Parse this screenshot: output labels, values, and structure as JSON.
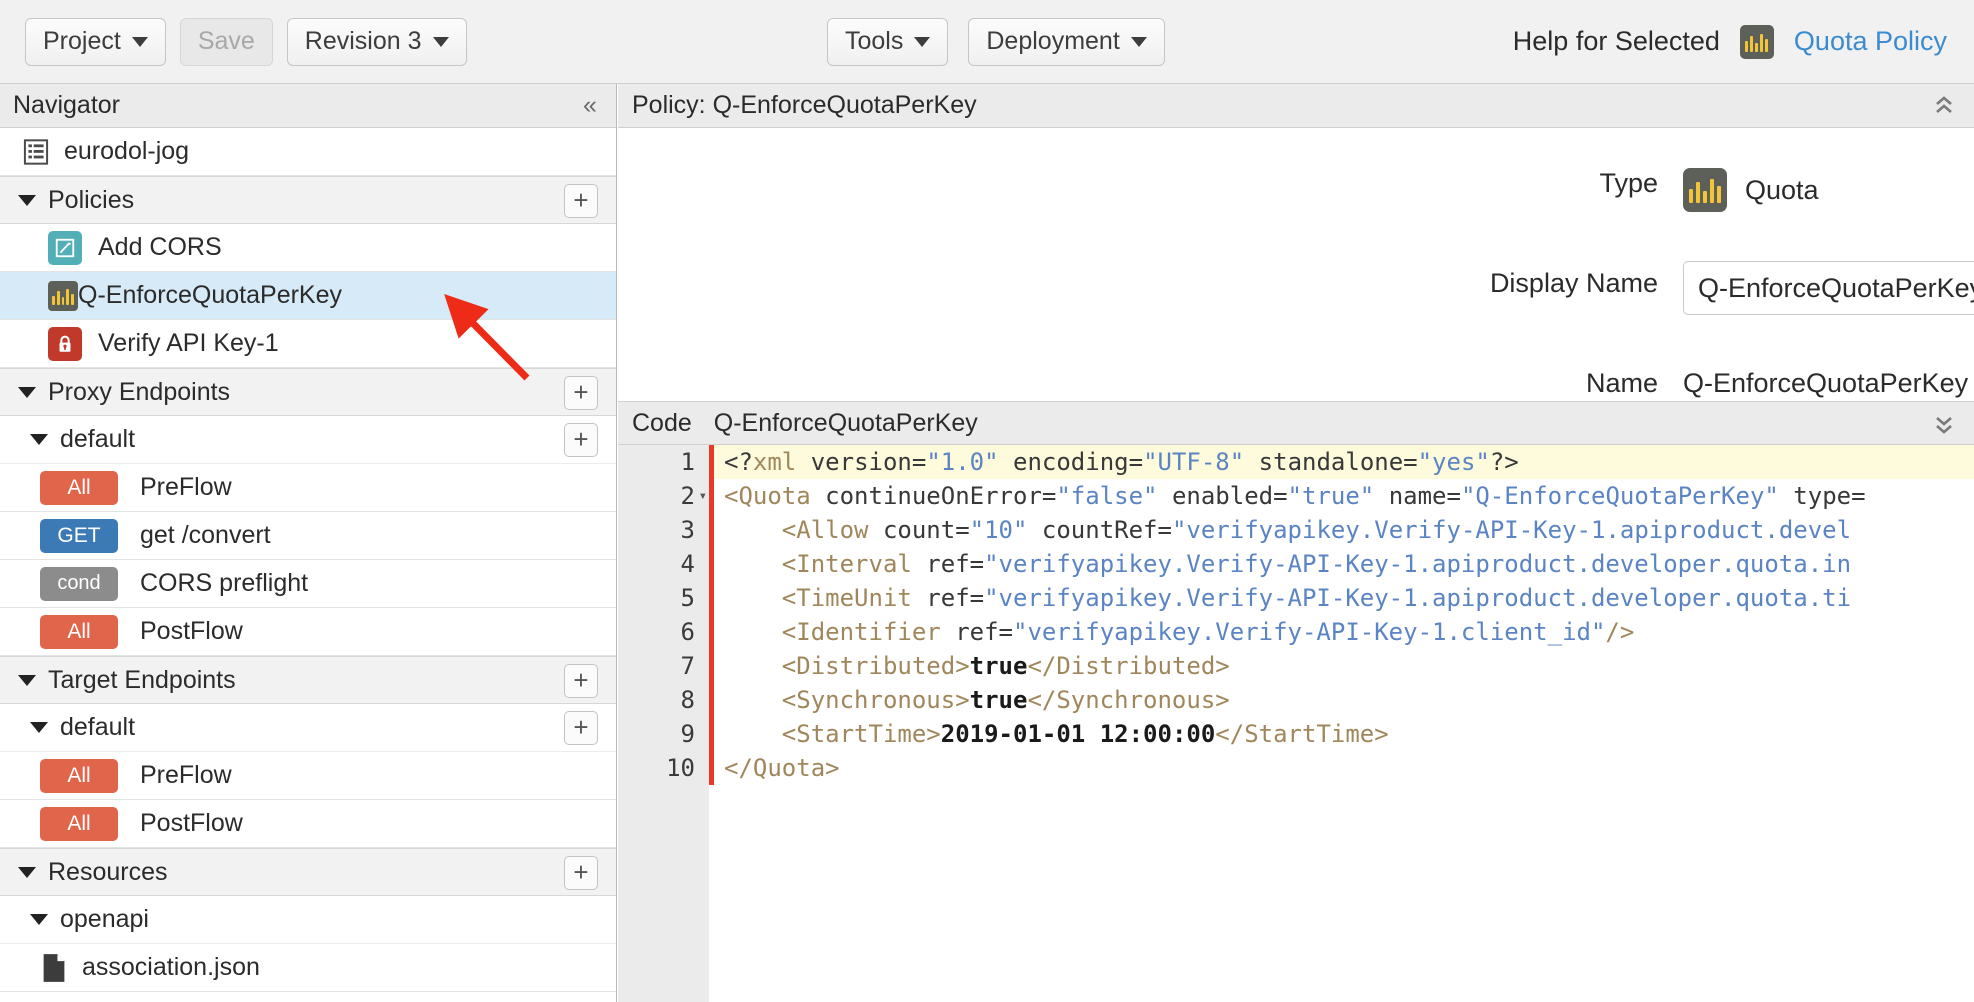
{
  "toolbar": {
    "project_label": "Project",
    "save_label": "Save",
    "revision_label": "Revision 3",
    "tools_label": "Tools",
    "deployment_label": "Deployment",
    "help_label": "Help for Selected",
    "quota_policy_link": "Quota Policy",
    "quota_icon": "quota-policy-icon",
    "accent_link_color": "#3b8bd0"
  },
  "sidebar": {
    "header": "Navigator",
    "collapse_icon": "«",
    "proxy_name": "eurodol-jog",
    "groups": [
      {
        "label": "Policies",
        "add_label": "+",
        "items": [
          {
            "label": "Add CORS",
            "icon": "edit-pencil-icon",
            "icon_color": "#52afb8",
            "selected": false
          },
          {
            "label": "Q-EnforceQuotaPerKey",
            "icon": "quota-policy-icon",
            "icon_color": "#5c6059",
            "selected": true
          },
          {
            "label": "Verify API Key-1",
            "icon": "padlock-icon",
            "icon_color": "#c0392b",
            "selected": false
          }
        ]
      },
      {
        "label": "Proxy Endpoints",
        "add_label": "+",
        "endpoint": "default",
        "endpoint_add_label": "+",
        "flows": [
          {
            "badge": "All",
            "badge_type": "all",
            "label": "PreFlow"
          },
          {
            "badge": "GET",
            "badge_type": "get",
            "label": "get /convert"
          },
          {
            "badge": "cond",
            "badge_type": "cond",
            "label": "CORS preflight"
          },
          {
            "badge": "All",
            "badge_type": "all",
            "label": "PostFlow"
          }
        ]
      },
      {
        "label": "Target Endpoints",
        "add_label": "+",
        "endpoint": "default",
        "endpoint_add_label": "+",
        "flows": [
          {
            "badge": "All",
            "badge_type": "all",
            "label": "PreFlow"
          },
          {
            "badge": "All",
            "badge_type": "all",
            "label": "PostFlow"
          }
        ]
      },
      {
        "label": "Resources",
        "add_label": "+",
        "folder": "openapi",
        "files": [
          {
            "label": "association.json",
            "icon": "file-icon"
          }
        ]
      }
    ],
    "badge_colors": {
      "all": "#e0654a",
      "get": "#3c7ab5",
      "cond": "#8c8c8c"
    }
  },
  "policy_panel": {
    "header": "Policy: Q-EnforceQuotaPerKey",
    "collapse_icon": "chevron-double-up-icon",
    "type_label": "Type",
    "type_value": "Quota",
    "type_icon": "quota-policy-icon",
    "display_name_label": "Display Name",
    "display_name_value": "Q-EnforceQuotaPerKey",
    "display_name_placeholder": "Display Name",
    "name_label": "Name",
    "name_value": "Q-EnforceQuotaPerKey"
  },
  "code_panel": {
    "code_label": "Code",
    "file_name": "Q-EnforceQuotaPerKey",
    "expand_icon": "chevron-double-down-icon",
    "line_numbers": [
      "1",
      "2",
      "3",
      "4",
      "5",
      "6",
      "7",
      "8",
      "9",
      "10"
    ],
    "lines": [
      {
        "n": "1",
        "highlighted": true,
        "foldable": false,
        "tokens": [
          {
            "t": "<?",
            "c": "punct"
          },
          {
            "t": "xml",
            "c": "proc"
          },
          {
            "t": " version=",
            "c": "attr"
          },
          {
            "t": "\"1.0\"",
            "c": "str"
          },
          {
            "t": " encoding=",
            "c": "attr"
          },
          {
            "t": "\"UTF-8\"",
            "c": "str"
          },
          {
            "t": " standalone=",
            "c": "attr"
          },
          {
            "t": "\"yes\"",
            "c": "str"
          },
          {
            "t": "?>",
            "c": "punct"
          }
        ]
      },
      {
        "n": "2",
        "highlighted": false,
        "foldable": true,
        "tokens": [
          {
            "t": "<Quota",
            "c": "tag"
          },
          {
            "t": " continueOnError=",
            "c": "attr"
          },
          {
            "t": "\"false\"",
            "c": "str"
          },
          {
            "t": " enabled=",
            "c": "attr"
          },
          {
            "t": "\"true\"",
            "c": "str"
          },
          {
            "t": " name=",
            "c": "attr"
          },
          {
            "t": "\"Q-EnforceQuotaPerKey\"",
            "c": "str"
          },
          {
            "t": " type=",
            "c": "attr"
          }
        ]
      },
      {
        "n": "3",
        "highlighted": false,
        "foldable": false,
        "tokens": [
          {
            "t": "    <Allow",
            "c": "tag"
          },
          {
            "t": " count=",
            "c": "attr"
          },
          {
            "t": "\"10\"",
            "c": "str"
          },
          {
            "t": " countRef=",
            "c": "attr"
          },
          {
            "t": "\"verifyapikey.Verify-API-Key-1.apiproduct.devel",
            "c": "str"
          }
        ]
      },
      {
        "n": "4",
        "highlighted": false,
        "foldable": false,
        "tokens": [
          {
            "t": "    <Interval",
            "c": "tag"
          },
          {
            "t": " ref=",
            "c": "attr"
          },
          {
            "t": "\"verifyapikey.Verify-API-Key-1.apiproduct.developer.quota.in",
            "c": "str"
          }
        ]
      },
      {
        "n": "5",
        "highlighted": false,
        "foldable": false,
        "tokens": [
          {
            "t": "    <TimeUnit",
            "c": "tag"
          },
          {
            "t": " ref=",
            "c": "attr"
          },
          {
            "t": "\"verifyapikey.Verify-API-Key-1.apiproduct.developer.quota.ti",
            "c": "str"
          }
        ]
      },
      {
        "n": "6",
        "highlighted": false,
        "foldable": false,
        "tokens": [
          {
            "t": "    <Identifier",
            "c": "tag"
          },
          {
            "t": " ref=",
            "c": "attr"
          },
          {
            "t": "\"verifyapikey.Verify-API-Key-1.client_id\"",
            "c": "str"
          },
          {
            "t": "/>",
            "c": "tag"
          }
        ]
      },
      {
        "n": "7",
        "highlighted": false,
        "foldable": false,
        "tokens": [
          {
            "t": "    <Distributed>",
            "c": "tag"
          },
          {
            "t": "true",
            "c": "text"
          },
          {
            "t": "</Distributed>",
            "c": "tag"
          }
        ]
      },
      {
        "n": "8",
        "highlighted": false,
        "foldable": false,
        "tokens": [
          {
            "t": "    <Synchronous>",
            "c": "tag"
          },
          {
            "t": "true",
            "c": "text"
          },
          {
            "t": "</Synchronous>",
            "c": "tag"
          }
        ]
      },
      {
        "n": "9",
        "highlighted": false,
        "foldable": false,
        "tokens": [
          {
            "t": "    <StartTime>",
            "c": "tag"
          },
          {
            "t": "2019-01-01 12:00:00",
            "c": "text"
          },
          {
            "t": "</StartTime>",
            "c": "tag"
          }
        ]
      },
      {
        "n": "10",
        "highlighted": false,
        "foldable": false,
        "tokens": [
          {
            "t": "</Quota>",
            "c": "tag"
          }
        ]
      }
    ]
  },
  "annotation": {
    "arrow_color": "#ee2b17",
    "points_to": "Q-EnforceQuotaPerKey"
  }
}
